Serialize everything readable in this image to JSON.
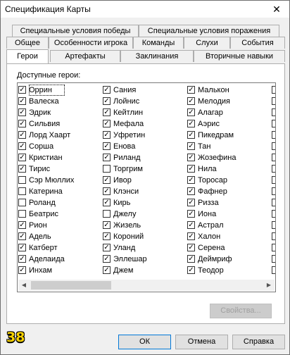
{
  "window": {
    "title": "Спецификация Карты",
    "close_glyph": "✕"
  },
  "tabs": {
    "row1": [
      "Специальные условия победы",
      "Специальные условия поражения"
    ],
    "row2": [
      "Общее",
      "Особенности игрока",
      "Команды",
      "Слухи",
      "События"
    ],
    "row3": [
      "Герои",
      "Артефакты",
      "Заклинания",
      "Вторичные навыки"
    ],
    "active": "Герои"
  },
  "heroes_panel": {
    "label": "Доступные герои:",
    "columns": [
      [
        {
          "name": "Оррин",
          "checked": true
        },
        {
          "name": "Валеска",
          "checked": true
        },
        {
          "name": "Эдрик",
          "checked": true
        },
        {
          "name": "Сильвия",
          "checked": true
        },
        {
          "name": "Лорд Хаарт",
          "checked": true
        },
        {
          "name": "Сорша",
          "checked": true
        },
        {
          "name": "Кристиан",
          "checked": true
        },
        {
          "name": "Тирис",
          "checked": true
        },
        {
          "name": "Сэр Мюллих",
          "checked": false
        },
        {
          "name": "Катерина",
          "checked": false
        },
        {
          "name": "Роланд",
          "checked": false
        },
        {
          "name": "Беатрис",
          "checked": false
        },
        {
          "name": "Рион",
          "checked": true
        },
        {
          "name": "Адель",
          "checked": true
        },
        {
          "name": "Катберт",
          "checked": true
        },
        {
          "name": "Аделаида",
          "checked": true
        },
        {
          "name": "Инхам",
          "checked": true
        }
      ],
      [
        {
          "name": "Сания",
          "checked": true
        },
        {
          "name": "Лойнис",
          "checked": true
        },
        {
          "name": "Кейтлин",
          "checked": true
        },
        {
          "name": "Мефала",
          "checked": true
        },
        {
          "name": "Уфретин",
          "checked": true
        },
        {
          "name": "Енова",
          "checked": true
        },
        {
          "name": "Риланд",
          "checked": true
        },
        {
          "name": "Торгрим",
          "checked": false
        },
        {
          "name": "Ивор",
          "checked": true
        },
        {
          "name": "Клэнси",
          "checked": true
        },
        {
          "name": "Кирь",
          "checked": true
        },
        {
          "name": "Джелу",
          "checked": false
        },
        {
          "name": "Жизель",
          "checked": true
        },
        {
          "name": "Короний",
          "checked": true
        },
        {
          "name": "Уланд",
          "checked": true
        },
        {
          "name": "Эллешар",
          "checked": true
        },
        {
          "name": "Джем",
          "checked": true
        }
      ],
      [
        {
          "name": "Малькон",
          "checked": true
        },
        {
          "name": "Мелодия",
          "checked": true
        },
        {
          "name": "Алагар",
          "checked": true
        },
        {
          "name": "Аэрис",
          "checked": true
        },
        {
          "name": "Пикедрам",
          "checked": true
        },
        {
          "name": "Тан",
          "checked": true
        },
        {
          "name": "Жозефина",
          "checked": true
        },
        {
          "name": "Нила",
          "checked": true
        },
        {
          "name": "Торосар",
          "checked": true
        },
        {
          "name": "Фафнер",
          "checked": true
        },
        {
          "name": "Ризза",
          "checked": true
        },
        {
          "name": "Иона",
          "checked": true
        },
        {
          "name": "Астрал",
          "checked": true
        },
        {
          "name": "Халон",
          "checked": true
        },
        {
          "name": "Серена",
          "checked": true
        },
        {
          "name": "Деймриф",
          "checked": true
        },
        {
          "name": "Теодор",
          "checked": true
        }
      ]
    ],
    "properties_button": "Свойства..."
  },
  "footer": {
    "badge": "38",
    "ok": "ОК",
    "cancel": "Отмена",
    "help": "Справка"
  },
  "icons": {
    "check_glyph": "✓",
    "scroll_left": "◀",
    "scroll_right": "▶"
  }
}
